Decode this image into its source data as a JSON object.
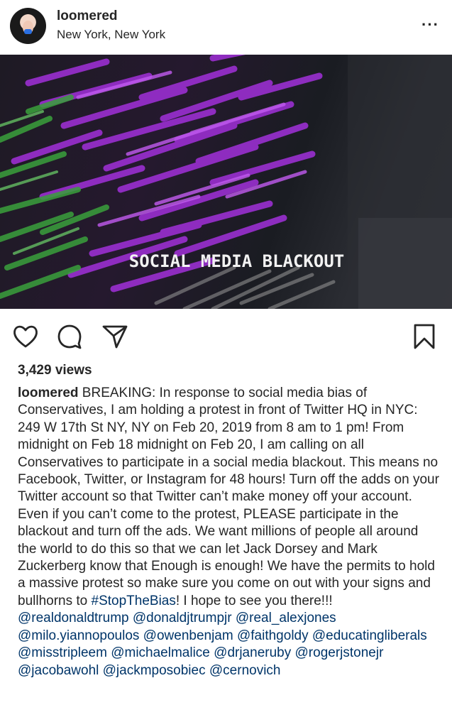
{
  "post": {
    "username": "loomered",
    "location": "New York, New York",
    "more_icon": "···",
    "media_text": "SOCIAL MEDIA BLACKOUT",
    "views": "3,429 views"
  },
  "icons": [
    "heart-icon",
    "comment-icon",
    "share-icon",
    "bookmark-icon",
    "more-icon"
  ],
  "caption": {
    "author": "loomered",
    "body": " BREAKING: In response to social media bias of Conservatives, I am holding a protest in front of Twitter HQ in NYC: 249 W 17th St NY, NY on Feb 20, 2019 from 8 am to 1 pm! From midnight on Feb 18 midnight on Feb 20, I am calling on all Conservatives to participate in a social media blackout. This means no Facebook, Twitter, or Instagram for 48 hours! Turn off the adds on your Twitter account so that Twitter can’t make money off your account. Even if you can’t come to the protest, PLEASE participate in the blackout and turn off the ads. We want millions of people all around the world to do this so that we can let Jack Dorsey and Mark Zuckerberg know that Enough is enough! We have the permits to hold a massive protest so make sure you come on out with your signs and bullhorns to ",
    "hashtag": "#StopTheBias",
    "after_hashtag": "! I hope to see you there!!! ",
    "mentions": [
      "@realdonaldtrump",
      "@donaldjtrumpjr",
      "@real_alexjones",
      "@milo.yiannopoulos",
      "@owenbenjam",
      "@faithgoldy",
      "@educatingliberals",
      "@misstripleem",
      "@michaelmalice",
      "@drjaneruby",
      "@rogerjstonejr",
      "@jacobawohl",
      "@jackmposobiec",
      "@cernovich"
    ]
  }
}
